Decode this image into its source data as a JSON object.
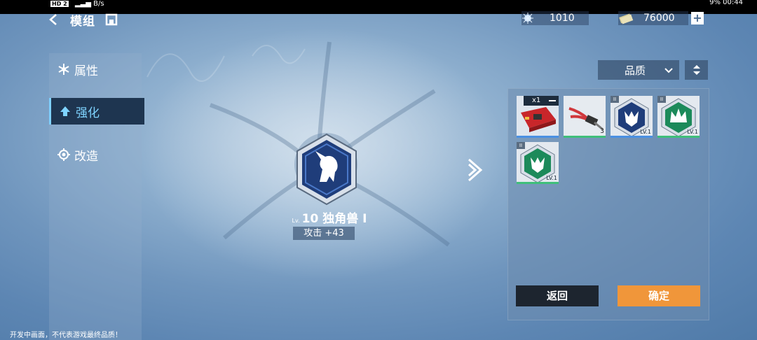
{
  "status_bar": {
    "hd_label": "HD 2",
    "net_speed": "B/s",
    "right_text": "9% 00:44"
  },
  "header": {
    "title": "模组",
    "back_icon": "back-arrow-icon",
    "home_icon": "home-icon",
    "resources": [
      {
        "name": "crystal",
        "icon": "crystal-icon",
        "value": "1010"
      },
      {
        "name": "money",
        "icon": "money-icon",
        "value": "76000"
      }
    ],
    "plus_label": "+"
  },
  "sidebar": {
    "items": [
      {
        "label": "属性",
        "icon": "snowflake-icon",
        "active": false
      },
      {
        "label": "强化",
        "icon": "up-arrow-icon",
        "active": true
      },
      {
        "label": "改造",
        "icon": "gear-icon",
        "active": false
      }
    ]
  },
  "module": {
    "lv_prefix": "Lv.",
    "level": "10",
    "name": "独角兽 I",
    "stat": "攻击 +43",
    "icon": "unicorn-icon"
  },
  "sort": {
    "selected": "品质",
    "chevron": "chevron-down-icon",
    "order_icon": "sort-updown-icon"
  },
  "inventory": {
    "items": [
      {
        "type": "material-board",
        "qty": "x1",
        "selected": true,
        "line_color": "#4a90e2"
      },
      {
        "type": "material-tool",
        "count": "3",
        "line_color": "#3fbf7a"
      },
      {
        "type": "module-blue",
        "tier": "II",
        "level": "LV.1",
        "line_color": "#4a90e2"
      },
      {
        "type": "module-green-crown",
        "tier": "II",
        "level": "LV.1",
        "line_color": "#3fbf7a"
      },
      {
        "type": "module-green",
        "tier": "II",
        "level": "LV.1",
        "line_color": "#3fbf7a"
      }
    ]
  },
  "buttons": {
    "back": "返回",
    "confirm": "确定"
  },
  "footer": {
    "note": "开发中画面，不代表游戏最终品质！"
  },
  "colors": {
    "accent_blue": "#7fd4ff",
    "confirm_orange": "#f0963a",
    "dark_panel": "#1d252f"
  }
}
